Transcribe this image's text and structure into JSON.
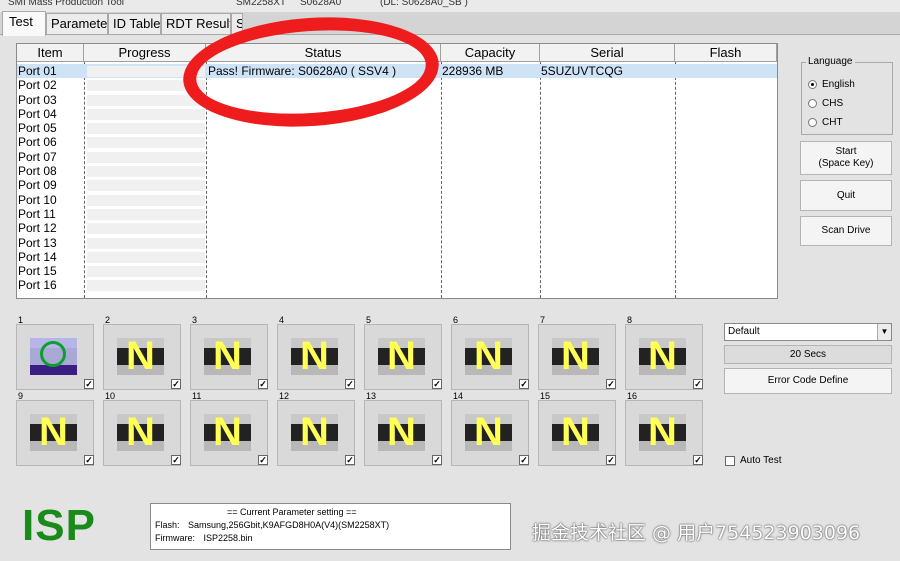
{
  "window": {
    "title_fragments": [
      "SMI Mass Production Tool",
      "SM2258XT",
      "S0628A0",
      "(DL: S0628A0_SB )"
    ]
  },
  "tabs": [
    {
      "label": "Test",
      "active": true
    },
    {
      "label": "Parameter",
      "active": false
    },
    {
      "label": "ID Table",
      "active": false
    },
    {
      "label": "RDT Result",
      "active": false
    },
    {
      "label": "S",
      "active": false
    }
  ],
  "grid": {
    "columns": [
      "Item",
      "Progress",
      "Status",
      "Capacity",
      "Serial",
      "Flash"
    ],
    "rows": [
      {
        "item": "Port 01",
        "status": "Pass!  Firmware: S0628A0  ( SSV4 )",
        "capacity": "228936 MB",
        "serial": "5SUZUVTCQG",
        "flash": ""
      },
      {
        "item": "Port 02",
        "status": "",
        "capacity": "",
        "serial": "",
        "flash": ""
      },
      {
        "item": "Port 03",
        "status": "",
        "capacity": "",
        "serial": "",
        "flash": ""
      },
      {
        "item": "Port 04",
        "status": "",
        "capacity": "",
        "serial": "",
        "flash": ""
      },
      {
        "item": "Port 05",
        "status": "",
        "capacity": "",
        "serial": "",
        "flash": ""
      },
      {
        "item": "Port 06",
        "status": "",
        "capacity": "",
        "serial": "",
        "flash": ""
      },
      {
        "item": "Port 07",
        "status": "",
        "capacity": "",
        "serial": "",
        "flash": ""
      },
      {
        "item": "Port 08",
        "status": "",
        "capacity": "",
        "serial": "",
        "flash": ""
      },
      {
        "item": "Port 09",
        "status": "",
        "capacity": "",
        "serial": "",
        "flash": ""
      },
      {
        "item": "Port 10",
        "status": "",
        "capacity": "",
        "serial": "",
        "flash": ""
      },
      {
        "item": "Port 11",
        "status": "",
        "capacity": "",
        "serial": "",
        "flash": ""
      },
      {
        "item": "Port 12",
        "status": "",
        "capacity": "",
        "serial": "",
        "flash": ""
      },
      {
        "item": "Port 13",
        "status": "",
        "capacity": "",
        "serial": "",
        "flash": ""
      },
      {
        "item": "Port 14",
        "status": "",
        "capacity": "",
        "serial": "",
        "flash": ""
      },
      {
        "item": "Port 15",
        "status": "",
        "capacity": "",
        "serial": "",
        "flash": ""
      },
      {
        "item": "Port 16",
        "status": "",
        "capacity": "",
        "serial": "",
        "flash": ""
      }
    ]
  },
  "language": {
    "legend": "Language",
    "options": [
      {
        "label": "English",
        "selected": true
      },
      {
        "label": "CHS",
        "selected": false
      },
      {
        "label": "CHT",
        "selected": false
      }
    ]
  },
  "buttons": {
    "start": "Start\n(Space Key)",
    "quit": "Quit",
    "scan_drive": "Scan Drive"
  },
  "ports": [
    {
      "num": "1",
      "state": "pass",
      "letter": "",
      "checked": true
    },
    {
      "num": "2",
      "state": "none",
      "letter": "N",
      "checked": true
    },
    {
      "num": "3",
      "state": "none",
      "letter": "N",
      "checked": true
    },
    {
      "num": "4",
      "state": "none",
      "letter": "N",
      "checked": true
    },
    {
      "num": "5",
      "state": "none",
      "letter": "N",
      "checked": true
    },
    {
      "num": "6",
      "state": "none",
      "letter": "N",
      "checked": true
    },
    {
      "num": "7",
      "state": "none",
      "letter": "N",
      "checked": true
    },
    {
      "num": "8",
      "state": "none",
      "letter": "N",
      "checked": true
    },
    {
      "num": "9",
      "state": "none",
      "letter": "N",
      "checked": true
    },
    {
      "num": "10",
      "state": "none",
      "letter": "N",
      "checked": true
    },
    {
      "num": "11",
      "state": "none",
      "letter": "N",
      "checked": true
    },
    {
      "num": "12",
      "state": "none",
      "letter": "N",
      "checked": true
    },
    {
      "num": "13",
      "state": "none",
      "letter": "N",
      "checked": true
    },
    {
      "num": "14",
      "state": "none",
      "letter": "N",
      "checked": true
    },
    {
      "num": "15",
      "state": "none",
      "letter": "N",
      "checked": true
    },
    {
      "num": "16",
      "state": "none",
      "letter": "N",
      "checked": true
    }
  ],
  "profile": {
    "selected": "Default"
  },
  "timer": {
    "label": "20 Secs"
  },
  "error_code_button": "Error Code Define",
  "auto_test": {
    "label": "Auto Test",
    "checked": false
  },
  "logo": {
    "text": "ISP",
    "color": "#1a8a1a"
  },
  "parameter_box": {
    "heading": "== Current Parameter setting ==",
    "flash_label": "Flash:",
    "flash_value": "Samsung,256Gbit,K9AFGD8H0A(V4)(SM2258XT)",
    "firmware_label": "Firmware:",
    "firmware_value": "ISP2258.bin"
  },
  "watermark": "掘金技术社区 @ 用户754523903096",
  "annotation": {
    "shape": "red-ellipse-icon",
    "color": "#ee1c1c"
  }
}
